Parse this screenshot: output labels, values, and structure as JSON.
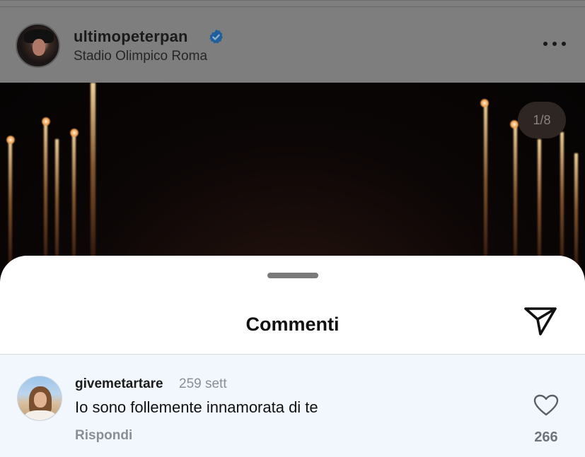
{
  "post": {
    "username": "ultimopeterpan",
    "location": "Stadio Olimpico Roma",
    "media_counter": "1/8",
    "verified_color": "#3897f0"
  },
  "sheet": {
    "title": "Commenti"
  },
  "comment": {
    "username": "givemetartare",
    "time": "259 sett",
    "text": "Io sono follemente innamorata di te",
    "reply_label": "Rispondi",
    "like_count": "266"
  },
  "icons": {
    "more": "more-options-icon",
    "share": "paper-plane-icon",
    "like": "heart-outline-icon",
    "verified": "verified-badge-icon"
  }
}
